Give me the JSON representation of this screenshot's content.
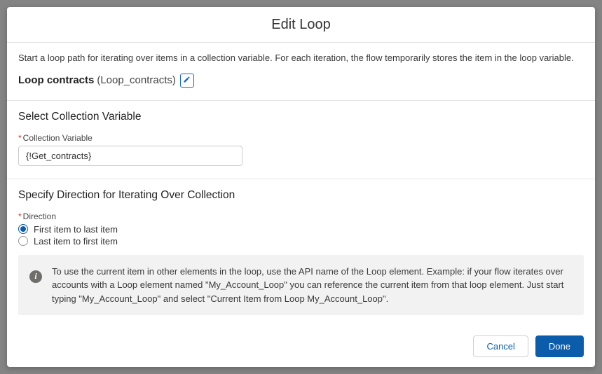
{
  "modal": {
    "title": "Edit Loop",
    "intro_text": "Start a loop path for iterating over items in a collection variable. For each iteration, the flow temporarily stores the item in the loop variable.",
    "loop_label": "Loop contracts",
    "loop_api_name": "(Loop_contracts)"
  },
  "collection_section": {
    "title": "Select Collection Variable",
    "field_label": "Collection Variable",
    "value": "{!Get_contracts}"
  },
  "direction_section": {
    "title": "Specify Direction for Iterating Over Collection",
    "field_label": "Direction",
    "options": [
      {
        "label": "First item to last item",
        "selected": true
      },
      {
        "label": "Last item to first item",
        "selected": false
      }
    ],
    "info_text": "To use the current item in other elements in the loop, use the API name of the Loop element. Example: if your flow iterates over accounts with a Loop element named \"My_Account_Loop\" you can reference the current item from that loop element. Just start typing \"My_Account_Loop\" and select \"Current Item from Loop My_Account_Loop\"."
  },
  "footer": {
    "cancel": "Cancel",
    "done": "Done"
  }
}
